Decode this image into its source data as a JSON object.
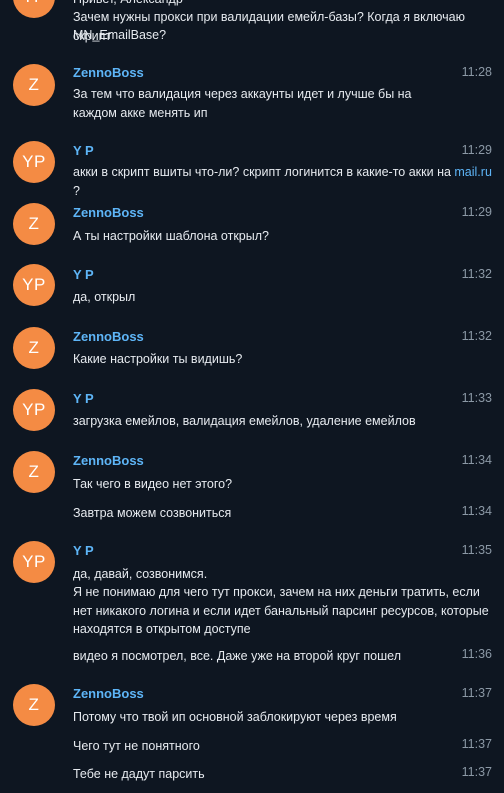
{
  "colors": {
    "background": "#0e1621",
    "avatar": "#f48b44",
    "sender": "#5eb5f7",
    "time": "#8b98a5",
    "text": "#e6eaef",
    "link": "#5eb5f7"
  },
  "top_fragment": {
    "line_cut": "Привет, Александр",
    "line1": "Зачем нужны прокси при валидации емейл-базы? Когда я включаю скрипт",
    "line2": "MN_EmailBase?"
  },
  "users": {
    "zb": {
      "name": "ZennoBoss",
      "initials": "Z"
    },
    "yp": {
      "name": "Y P",
      "initials": "YP"
    }
  },
  "messages": {
    "m1": {
      "time": "11:28",
      "text": "За тем что валидация через аккаунты идет и лучше бы на каждом акке менять ип"
    },
    "m2": {
      "time": "11:29",
      "text_before": "акки в скрипт вшиты что-ли? скрипт логинится в какие-то акки на ",
      "link": "mail.ru",
      "text_after": " ?"
    },
    "m3": {
      "time": "11:29",
      "text": "А ты настройки шаблона открыл?"
    },
    "m4": {
      "time": "11:32",
      "text": "да, открыл"
    },
    "m5": {
      "time": "11:32",
      "text": "Какие настройки ты видишь?"
    },
    "m6": {
      "time": "11:33",
      "text": "загрузка емейлов, валидация емейлов, удаление емейлов"
    },
    "m7": {
      "time": "11:34",
      "text": "Так чего в видео нет этого?"
    },
    "m8": {
      "time": "11:34",
      "text": "Завтра можем созвониться"
    },
    "m9": {
      "time": "11:35",
      "line1": "да, давай, созвонимся.",
      "line2": "Я не понимаю для чего тут прокси, зачем на них деньги тратить, если нет никакого логина и если идет банальный парсинг ресурсов, которые находятся в открытом доступе"
    },
    "m10": {
      "time": "11:36",
      "text": "видео я посмотрел, все. Даже уже на второй круг пошел"
    },
    "m11": {
      "time": "11:37",
      "text": "Потому что твой ип основной заблокируют через время"
    },
    "m12": {
      "time": "11:37",
      "text": "Чего тут не понятного"
    },
    "m13": {
      "time": "11:37",
      "text": "Тебе не дадут парсить"
    }
  }
}
